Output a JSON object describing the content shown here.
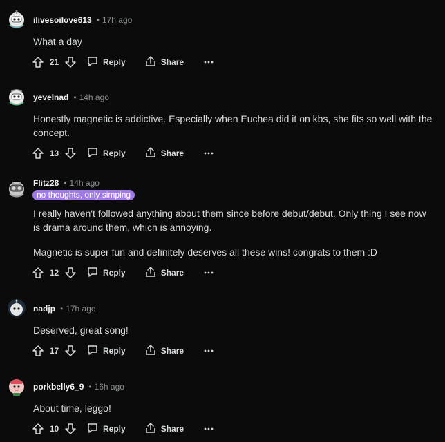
{
  "comments": [
    {
      "username": "ilivesoilove613",
      "time": "17h ago",
      "avatar": "robot-white-helmet-avatar",
      "flair": "",
      "paragraphs": [
        "What a day"
      ],
      "votes": "21",
      "reply_label": "Reply",
      "share_label": "Share"
    },
    {
      "username": "yevelnad",
      "time": "14h ago",
      "avatar": "robot-white-helmet-avatar",
      "flair": "",
      "paragraphs": [
        "Honestly magnetic is addictive. Especially when Euchea did it on kbs, she fits so well with the",
        "concept."
      ],
      "votes": "13",
      "reply_label": "Reply",
      "share_label": "Share"
    },
    {
      "username": "Flitz28",
      "time": "14h ago",
      "avatar": "robot-gray-goggles-avatar",
      "flair": "no thoughts, only simping",
      "paragraphs": [
        "I really haven't followed anything about them since before debut/debut. Only thing I see now",
        "is drama around them, which is annoying.",
        "Magnetic is super fun and definitely deserves all these wins! congrats to them :D"
      ],
      "votes": "12",
      "reply_label": "Reply",
      "share_label": "Share"
    },
    {
      "username": "nadjp",
      "time": "17h ago",
      "avatar": "robot-dark-blue-avatar",
      "flair": "",
      "paragraphs": [
        "Deserved, great song!"
      ],
      "votes": "17",
      "reply_label": "Reply",
      "share_label": "Share"
    },
    {
      "username": "porkbelly6_9",
      "time": "16h ago",
      "avatar": "robot-pink-avatar",
      "flair": "",
      "paragraphs": [
        "About time, leggo!"
      ],
      "votes": "10",
      "reply_label": "Reply",
      "share_label": "Share"
    }
  ],
  "colors": {
    "background": "#0b0b0b",
    "text": "#d7dadc",
    "muted": "#8b9093",
    "flair_bg": "#a07be8"
  },
  "icons": [
    "upvote-icon",
    "downvote-icon",
    "reply-icon",
    "share-icon",
    "more-options-icon"
  ]
}
